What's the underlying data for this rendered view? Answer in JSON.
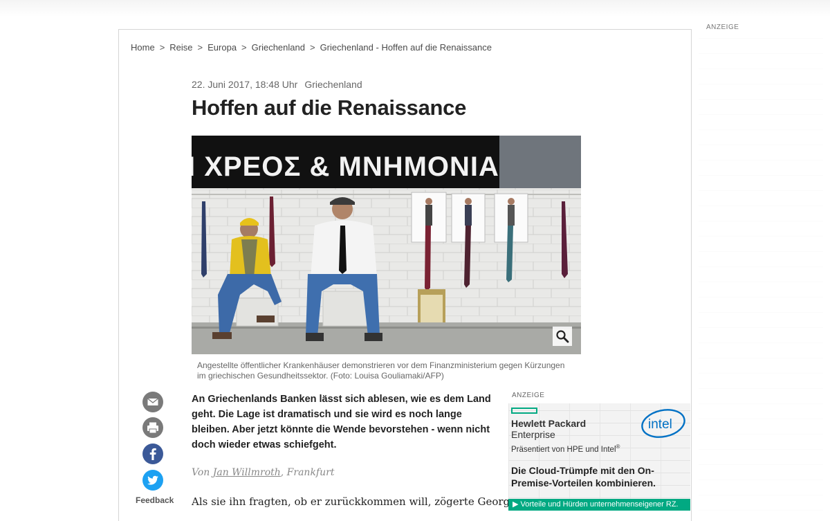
{
  "breadcrumb": {
    "items": [
      "Home",
      "Reise",
      "Europa",
      "Griechenland",
      "Griechenland - Hoffen auf die Renaissance"
    ],
    "separator": ">"
  },
  "article": {
    "date": "22. Juni 2017, 18:48 Uhr",
    "category": "Griechenland",
    "title": "Hoffen auf die Renaissance",
    "photo": {
      "banner_text": "Ι ΧΡΕΟΣ & ΜΝΗΜΟΝΙΑ",
      "caption": "Angestellte öffentlicher Krankenhäuser demonstrieren vor dem Finanzministerium gegen Kürzungen im griechischen Gesundheitssektor. (Foto: Louisa Gouliamaki/AFP)",
      "zoom_icon": "magnifier-icon"
    },
    "lead": "An Griechenlands Banken lässt sich ablesen, wie es dem Land geht. Die Lage ist dramatisch und sie wird es noch lange bleiben. Aber jetzt könnte die Wende bevorstehen - wenn nicht doch wieder etwas schiefgeht.",
    "byline": {
      "prefix": "Von",
      "author": "Jan Willmroth",
      "location": ", Frankfurt"
    },
    "body_first_line": "Als sie ihn fragten, ob er zurückkommen will, zögerte George"
  },
  "share": {
    "icons": [
      "mail-icon",
      "print-icon",
      "facebook-icon",
      "twitter-icon"
    ],
    "feedback_label": "Feedback",
    "colors": {
      "mail": "#7a7a7a",
      "print": "#7a7a7a",
      "facebook": "#3b5998",
      "twitter": "#1da1f2"
    }
  },
  "ads": {
    "right_label": "ANZEIGE",
    "inline_label": "ANZEIGE",
    "inline": {
      "brand_line1": "Hewlett Packard",
      "brand_line2": "Enterprise",
      "presented_by": "Präsentiert von HPE und Intel",
      "presented_sup": "®",
      "intel_logo": "intel",
      "headline": "Die Cloud-Trümpfe mit den On-Premise-Vorteilen kombinieren.",
      "cta": "Vorteile und Hürden unternehmenseigener RZ.",
      "cta_icon": "play-triangle-icon",
      "accent": "#01a982",
      "intel_blue": "#0071c5"
    }
  }
}
